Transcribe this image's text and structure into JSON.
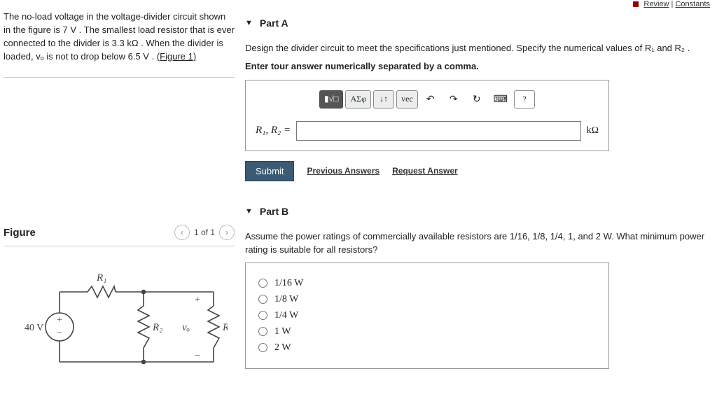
{
  "top_nav": {
    "review": "Review",
    "constants": "Constants"
  },
  "intro": {
    "line": "The no-load voltage in the voltage-divider circuit shown in the figure is 7 V . The smallest load resistor that is ever connected to the divider is 3.3 kΩ . When the divider is loaded, vₒ is not to drop below 6.5 V .",
    "figlink": "(Figure 1)"
  },
  "figure": {
    "title": "Figure",
    "counter": "1 of 1",
    "source_v": "40 V",
    "r1": "R₁",
    "r2": "R₂",
    "vo": "vₒ",
    "rl": "R_L",
    "plus": "+",
    "minus": "−"
  },
  "partA": {
    "title": "Part A",
    "question": "Design the divider circuit to meet the specifications just mentioned. Specify the numerical values of R₁ and R₂ .",
    "instr": "Enter tour answer numerically separated by a comma.",
    "vars": "R₁, R₂ =",
    "unit": "kΩ",
    "toolbar": {
      "t1": "▮√□",
      "t2": "ΑΣφ",
      "t3": "↓↑",
      "t4": "vec",
      "undo": "↶",
      "redo": "↷",
      "reset": "↻",
      "keyb": "⌨",
      "help": "?"
    },
    "submit": "Submit",
    "prev": "Previous Answers",
    "req": "Request Answer"
  },
  "partB": {
    "title": "Part B",
    "question": "Assume the power ratings of commercially available resistors are 1/16, 1/8, 1/4, 1, and 2 W. What minimum power rating is suitable for all resistors?",
    "options": [
      "1/16 W",
      "1/8 W",
      "1/4 W",
      "1 W",
      "2 W"
    ]
  }
}
